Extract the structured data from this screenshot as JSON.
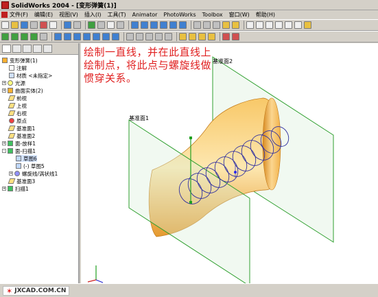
{
  "window": {
    "title": "SolidWorks 2004 - [变形弹簧(1)]"
  },
  "menu": [
    "文件(F)",
    "编辑(E)",
    "视图(V)",
    "插入(I)",
    "工具(T)",
    "Animator",
    "PhotoWorks",
    "Toolbox",
    "窗口(W)",
    "帮助(H)"
  ],
  "tree": {
    "items": [
      {
        "label": "变形弹簧(1)",
        "icon": "part-icon"
      },
      {
        "label": "注解",
        "icon": "annotation-icon"
      },
      {
        "label": "材质 <未指定>",
        "icon": "material-icon"
      },
      {
        "label": "光源",
        "icon": "light-icon"
      },
      {
        "label": "曲面实体(2)",
        "icon": "surface-body-icon"
      },
      {
        "label": "前视",
        "icon": "plane-icon"
      },
      {
        "label": "上视",
        "icon": "plane-icon"
      },
      {
        "label": "右视",
        "icon": "plane-icon"
      },
      {
        "label": "原点",
        "icon": "origin-icon"
      },
      {
        "label": "基准面1",
        "icon": "plane-icon"
      },
      {
        "label": "基准面2",
        "icon": "plane-icon"
      },
      {
        "label": "面-放样1",
        "icon": "loft-feature-icon"
      },
      {
        "label": "面-扫描1",
        "icon": "sweep-feature-icon"
      },
      {
        "label": "草图6",
        "icon": "sketch-icon"
      },
      {
        "label": "(-) 草图5",
        "icon": "sketch-icon"
      },
      {
        "label": "螺旋线/涡状线1",
        "icon": "helix-icon"
      },
      {
        "label": "基准面3",
        "icon": "plane-icon"
      },
      {
        "label": "扫描1",
        "icon": "sweep-feature-icon"
      }
    ]
  },
  "viewport": {
    "annotation": "绘制一直线，并在此直线上绘制点，将此点与螺旋线做惯穿关系。",
    "plane1_label": "基准面1",
    "plane2_label": "基准面2"
  },
  "watermark": {
    "text": "JXCAD.COM.CN"
  },
  "colors": {
    "annotation": "#e02020",
    "surface": "#f5b040",
    "helix": "#3030a0",
    "plane": "#30a030",
    "sketch_line": "#20a020"
  }
}
